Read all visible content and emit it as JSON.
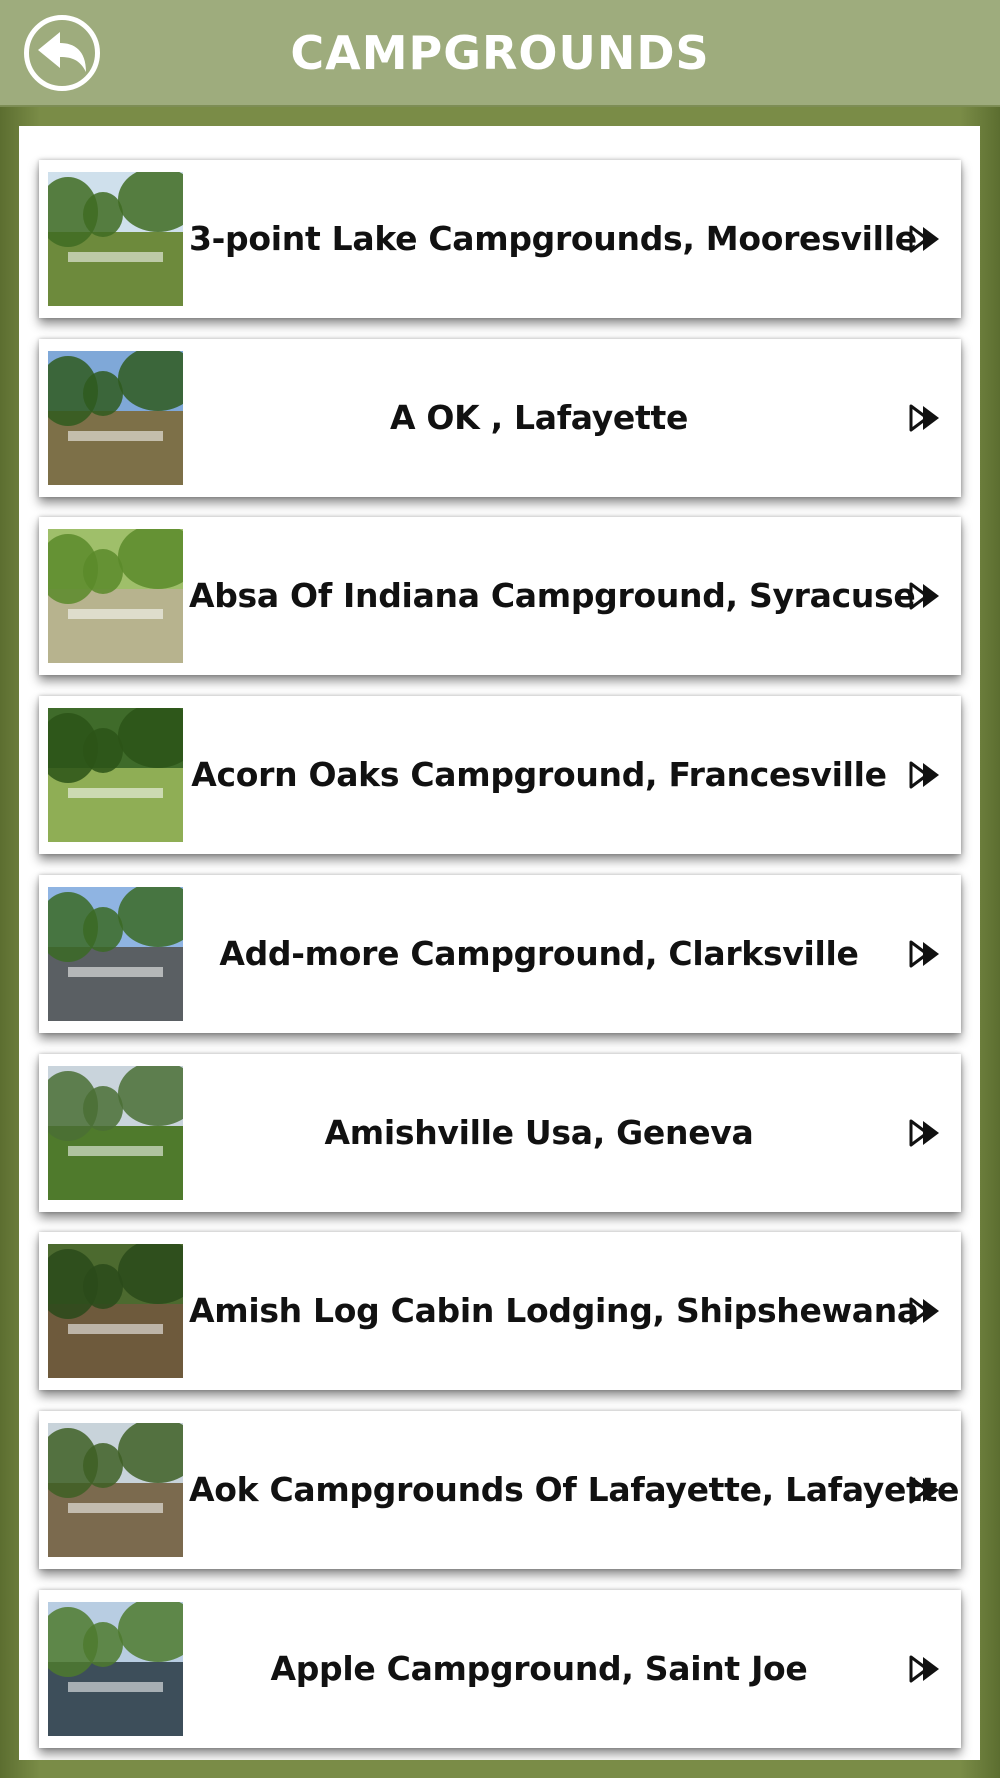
{
  "header": {
    "title": "CAMPGROUNDS",
    "back_icon": "back-arrow-icon"
  },
  "items": [
    {
      "label": "3-point Lake Campgrounds, Mooresville",
      "sky": "#cfe0ec",
      "ground": "#6d8a3c",
      "tree": "#3f6b22"
    },
    {
      "label": "A OK , Lafayette",
      "sky": "#7fa8d8",
      "ground": "#7d7048",
      "tree": "#2f5a1e"
    },
    {
      "label": "Absa Of Indiana Campground, Syracuse",
      "sky": "#9fbf6a",
      "ground": "#b7b38e",
      "tree": "#5a8a2a"
    },
    {
      "label": "Acorn Oaks Campground, Francesville",
      "sky": "#3f6b2a",
      "ground": "#8fae55",
      "tree": "#2c5418"
    },
    {
      "label": "Add-more Campground, Clarksville",
      "sky": "#8fb4e2",
      "ground": "#5a5f63",
      "tree": "#3b6a24"
    },
    {
      "label": "Amishville Usa, Geneva",
      "sky": "#c9d4dc",
      "ground": "#4f7a2c",
      "tree": "#4a6f35"
    },
    {
      "label": "Amish Log Cabin Lodging, Shipshewana",
      "sky": "#4c6a2f",
      "ground": "#6e5a3c",
      "tree": "#2a4a1a"
    },
    {
      "label": "Aok Campgrounds Of Lafayette, Lafayette",
      "sky": "#c8d3da",
      "ground": "#7b6a4e",
      "tree": "#3e5f25"
    },
    {
      "label": "Apple Campground, Saint Joe",
      "sky": "#b8cde2",
      "ground": "#3d4e5a",
      "tree": "#4d7a2e"
    }
  ],
  "row_icon": "double-play-arrow-icon"
}
